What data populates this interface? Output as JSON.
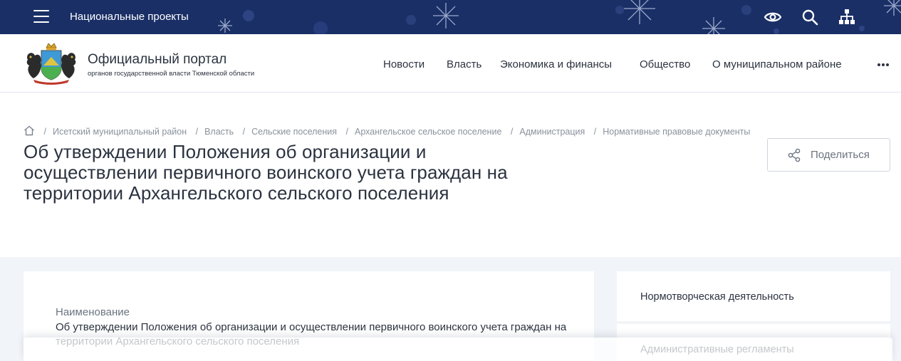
{
  "topbar": {
    "projects_link": "Национальные проекты",
    "icons": [
      "eye-icon",
      "search-icon",
      "sitemap-icon"
    ],
    "bg_color": "#1a2f66"
  },
  "header": {
    "title": "Официальный портал",
    "subtitle": "органов государственной власти Тюменской области",
    "nav": [
      "Новости",
      "Власть",
      "Экономика и финансы",
      "Общество",
      "О муниципальном районе"
    ],
    "more_icon": "more-dots-icon"
  },
  "breadcrumb": [
    "Исетский муниципальный район",
    "Власть",
    "Сельские поселения",
    "Архангельское сельское поселение",
    "Администрация",
    "Нормативные правовые документы"
  ],
  "page": {
    "title": "Об утверждении Положения об организации и осуществлении первичного воинского учета граждан на территории Архангельского сельского поселения",
    "share_label": "Поделиться"
  },
  "content": {
    "field_label": "Наименование",
    "field_value": "Об утверждении Положения об организации и осуществлении первичного воинского учета граждан на территории Архангельского сельского поселения"
  },
  "sidebar": {
    "items": [
      "Нормотворческая деятельность",
      "Административные регламенты"
    ]
  }
}
